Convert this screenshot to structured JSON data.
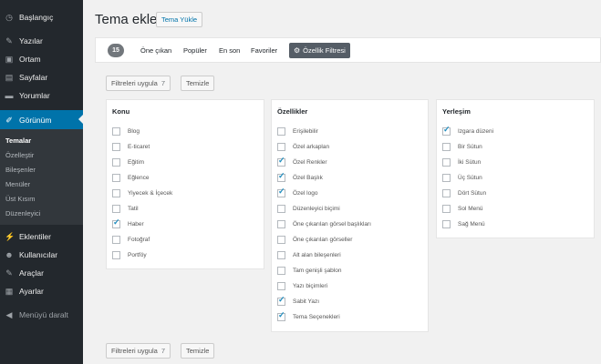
{
  "sidebar": {
    "items": [
      {
        "label": "Başlangıç",
        "icon": "dashboard-icon",
        "glyph": "◷"
      },
      {
        "label": "Yazılar",
        "icon": "pin-icon",
        "glyph": "✎"
      },
      {
        "label": "Ortam",
        "icon": "media-icon",
        "glyph": "▣"
      },
      {
        "label": "Sayfalar",
        "icon": "pages-icon",
        "glyph": "▤"
      },
      {
        "label": "Yorumlar",
        "icon": "comments-icon",
        "glyph": "▬"
      },
      {
        "label": "Görünüm",
        "icon": "brush-icon",
        "glyph": "✐"
      },
      {
        "label": "Eklentiler",
        "icon": "plugin-icon",
        "glyph": "⚡"
      },
      {
        "label": "Kullanıcılar",
        "icon": "users-icon",
        "glyph": "☻"
      },
      {
        "label": "Araçlar",
        "icon": "tools-icon",
        "glyph": "✎"
      },
      {
        "label": "Ayarlar",
        "icon": "settings-icon",
        "glyph": "▦"
      }
    ],
    "submenu": [
      "Temalar",
      "Özelleştir",
      "Bileşenler",
      "Menüler",
      "Üst Kısım",
      "Düzenleyici"
    ],
    "collapse": {
      "label": "Menüyü daralt",
      "glyph": "◀"
    }
  },
  "header": {
    "title": "Tema ekle",
    "upload": "Tema Yükle"
  },
  "filter_bar": {
    "count": "15",
    "links": [
      "Öne çıkan",
      "Popüler",
      "En son",
      "Favoriler"
    ],
    "feature_filter": "Özellik Filtresi",
    "gear_glyph": "⚙"
  },
  "actions": {
    "apply": "Filtreleri uygula",
    "apply_count": "7",
    "clear": "Temizle"
  },
  "groups": {
    "konu": {
      "title": "Konu",
      "items": [
        {
          "label": "Blog",
          "checked": false
        },
        {
          "label": "E-ticaret",
          "checked": false
        },
        {
          "label": "Eğitim",
          "checked": false
        },
        {
          "label": "Eğlence",
          "checked": false
        },
        {
          "label": "Yiyecek & İçecek",
          "checked": false
        },
        {
          "label": "Tatil",
          "checked": false
        },
        {
          "label": "Haber",
          "checked": true
        },
        {
          "label": "Fotoğraf",
          "checked": false
        },
        {
          "label": "Portföy",
          "checked": false
        }
      ]
    },
    "ozellikler": {
      "title": "Özellikler",
      "items": [
        {
          "label": "Erişilebilir",
          "checked": false
        },
        {
          "label": "Özel arkaplan",
          "checked": false
        },
        {
          "label": "Özel Renkler",
          "checked": true
        },
        {
          "label": "Özel Başlık",
          "checked": true
        },
        {
          "label": "Özel logo",
          "checked": true
        },
        {
          "label": "Düzenleyici biçimi",
          "checked": false
        },
        {
          "label": "Öne çıkarılan görsel başlıkları",
          "checked": false
        },
        {
          "label": "Öne çıkarılan görseller",
          "checked": false
        },
        {
          "label": "Alt alan bileşenleri",
          "checked": false
        },
        {
          "label": "Tam genişli şablon",
          "checked": false
        },
        {
          "label": "Yazı biçimleri",
          "checked": false
        },
        {
          "label": "Sabit Yazı",
          "checked": true
        },
        {
          "label": "Tema Seçenekleri",
          "checked": true
        }
      ]
    },
    "yerlesim": {
      "title": "Yerleşim",
      "items": [
        {
          "label": "Izgara düzeni",
          "checked": true
        },
        {
          "label": "Bir Sütun",
          "checked": false
        },
        {
          "label": "İki Sütun",
          "checked": false
        },
        {
          "label": "Üç Sütun",
          "checked": false
        },
        {
          "label": "Dört Sütun",
          "checked": false
        },
        {
          "label": "Sol Menü",
          "checked": false
        },
        {
          "label": "Sağ Menü",
          "checked": false
        }
      ]
    }
  },
  "colors": {
    "sidebar": "#23282d",
    "active": "#0073aa",
    "check": "#1e8cbe"
  }
}
